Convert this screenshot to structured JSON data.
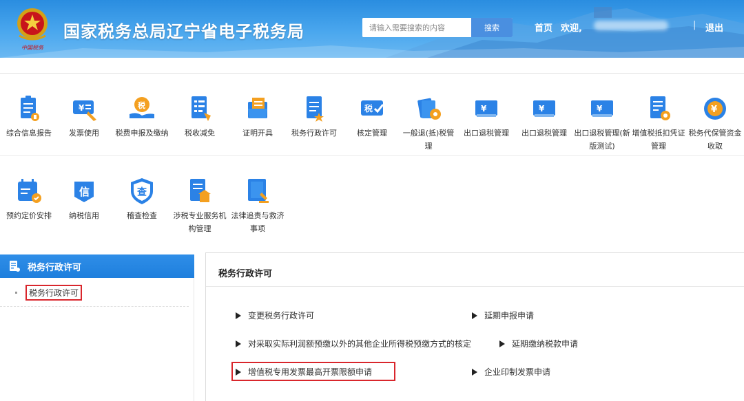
{
  "header": {
    "site_title": "国家税务总局辽宁省电子税务局",
    "search_placeholder": "请输入需要搜索的内容",
    "search_button": "搜索",
    "nav_home": "首页",
    "nav_welcome": "欢迎,",
    "nav_separator": "|",
    "nav_logout": "退出"
  },
  "modules_row1": [
    {
      "label": "综合信息报告",
      "icon": "report-icon"
    },
    {
      "label": "发票使用",
      "icon": "invoice-icon"
    },
    {
      "label": "税费申报及缴纳",
      "icon": "tax-declare-icon"
    },
    {
      "label": "税收减免",
      "icon": "tax-relief-icon"
    },
    {
      "label": "证明开具",
      "icon": "certificate-icon"
    },
    {
      "label": "税务行政许可",
      "icon": "admin-permit-icon"
    },
    {
      "label": "核定管理",
      "icon": "verify-manage-icon"
    },
    {
      "label": "一般退(抵)税管理",
      "icon": "refund-icon"
    },
    {
      "label": "出口退税管理",
      "icon": "export-refund-icon"
    },
    {
      "label": "出口退税管理",
      "icon": "export-refund-icon"
    },
    {
      "label": "出口退税管理(新版测试)",
      "icon": "export-refund-icon"
    },
    {
      "label": "增值税抵扣凭证管理",
      "icon": "vat-deduct-icon"
    },
    {
      "label": "税务代保管资金收取",
      "icon": "custody-fund-icon"
    }
  ],
  "modules_row2": [
    {
      "label": "预约定价安排",
      "icon": "pricing-calendar-icon"
    },
    {
      "label": "纳税信用",
      "icon": "credit-icon"
    },
    {
      "label": "稽查检查",
      "icon": "inspection-shield-icon"
    },
    {
      "label": "涉税专业服务机构管理",
      "icon": "agency-manage-icon"
    },
    {
      "label": "法律追责与救济事项",
      "icon": "legal-icon"
    }
  ],
  "left_panel": {
    "title": "税务行政许可",
    "items": [
      "税务行政许可"
    ]
  },
  "right_panel": {
    "title": "税务行政许可",
    "links": [
      "变更税务行政许可",
      "延期申报申请",
      "对采取实际利润额预缴以外的其他企业所得税预缴方式的核定",
      "延期缴纳税款申请",
      "增值税专用发票最高开票限额申请",
      "企业印制发票申请"
    ]
  },
  "colors": {
    "header_blue": "#2a8de0",
    "icon_blue": "#2b82e6",
    "icon_orange": "#f4a020",
    "highlight_red": "#d9262c"
  }
}
